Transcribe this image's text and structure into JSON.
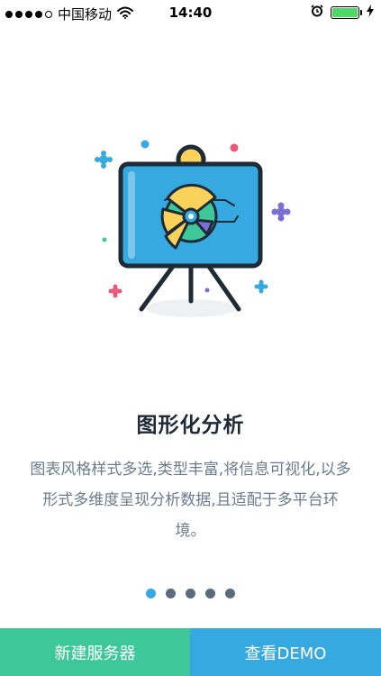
{
  "status_bar": {
    "carrier": "中国移动",
    "time": "14:40",
    "signal_strength": 4,
    "battery_level": 1.0
  },
  "icons": {
    "wifi": "wifi-icon",
    "alarm": "alarm-icon",
    "battery": "battery-icon",
    "charging": "charging-bolt-icon",
    "illustration": "presentation-board-pie-chart-icon"
  },
  "onboarding": {
    "title": "图形化分析",
    "description": "图表风格样式多选,类型丰富,将信息可视化,以多形式多维度呈现分析数据,且适配于多平台环境。",
    "page_count": 5,
    "current_page": 1
  },
  "actions": {
    "new_server": "新建服务器",
    "view_demo": "查看DEMO"
  },
  "colors": {
    "green_button": "#3ec89a",
    "blue_button": "#35a9e0",
    "board_blue": "#35a9e0",
    "dark_outline": "#1f2a37",
    "pie_yellow": "#f9d25c",
    "pie_green": "#3ec89a",
    "pie_purple": "#7b6fd6",
    "accent_pink": "#e85a7a"
  }
}
